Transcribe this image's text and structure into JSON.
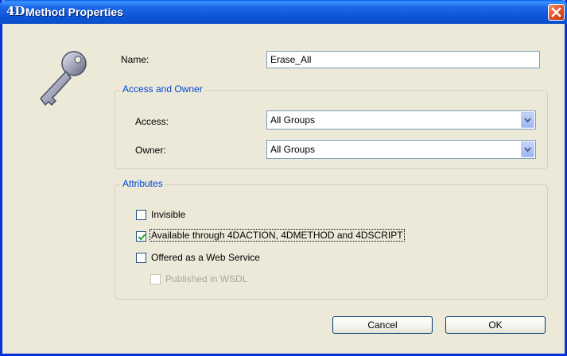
{
  "window": {
    "logo": "4D",
    "title": "Method Properties"
  },
  "form": {
    "name_label": "Name:",
    "name_value": "Erase_All"
  },
  "access_group": {
    "title": "Access and Owner",
    "access_label": "Access:",
    "access_value": "All Groups",
    "owner_label": "Owner:",
    "owner_value": "All Groups"
  },
  "attributes": {
    "title": "Attributes",
    "invisible": {
      "label": "Invisible",
      "checked": false
    },
    "available": {
      "label": "Available through 4DACTION, 4DMETHOD and 4DSCRIPT",
      "checked": true
    },
    "web_service": {
      "label": "Offered as a Web Service",
      "checked": false
    },
    "wsdl": {
      "label": "Published in WSDL",
      "checked": false,
      "disabled": true
    }
  },
  "buttons": {
    "cancel": "Cancel",
    "ok": "OK"
  },
  "icons": {
    "close": "close-icon",
    "key": "key-icon",
    "dropdown": "chevron-down-icon",
    "check": "checkmark-icon"
  },
  "colors": {
    "titlebar": "#0a5fe8",
    "dialog_bg": "#ece9d8",
    "group_title": "#0046d5",
    "close": "#e35a2e"
  }
}
